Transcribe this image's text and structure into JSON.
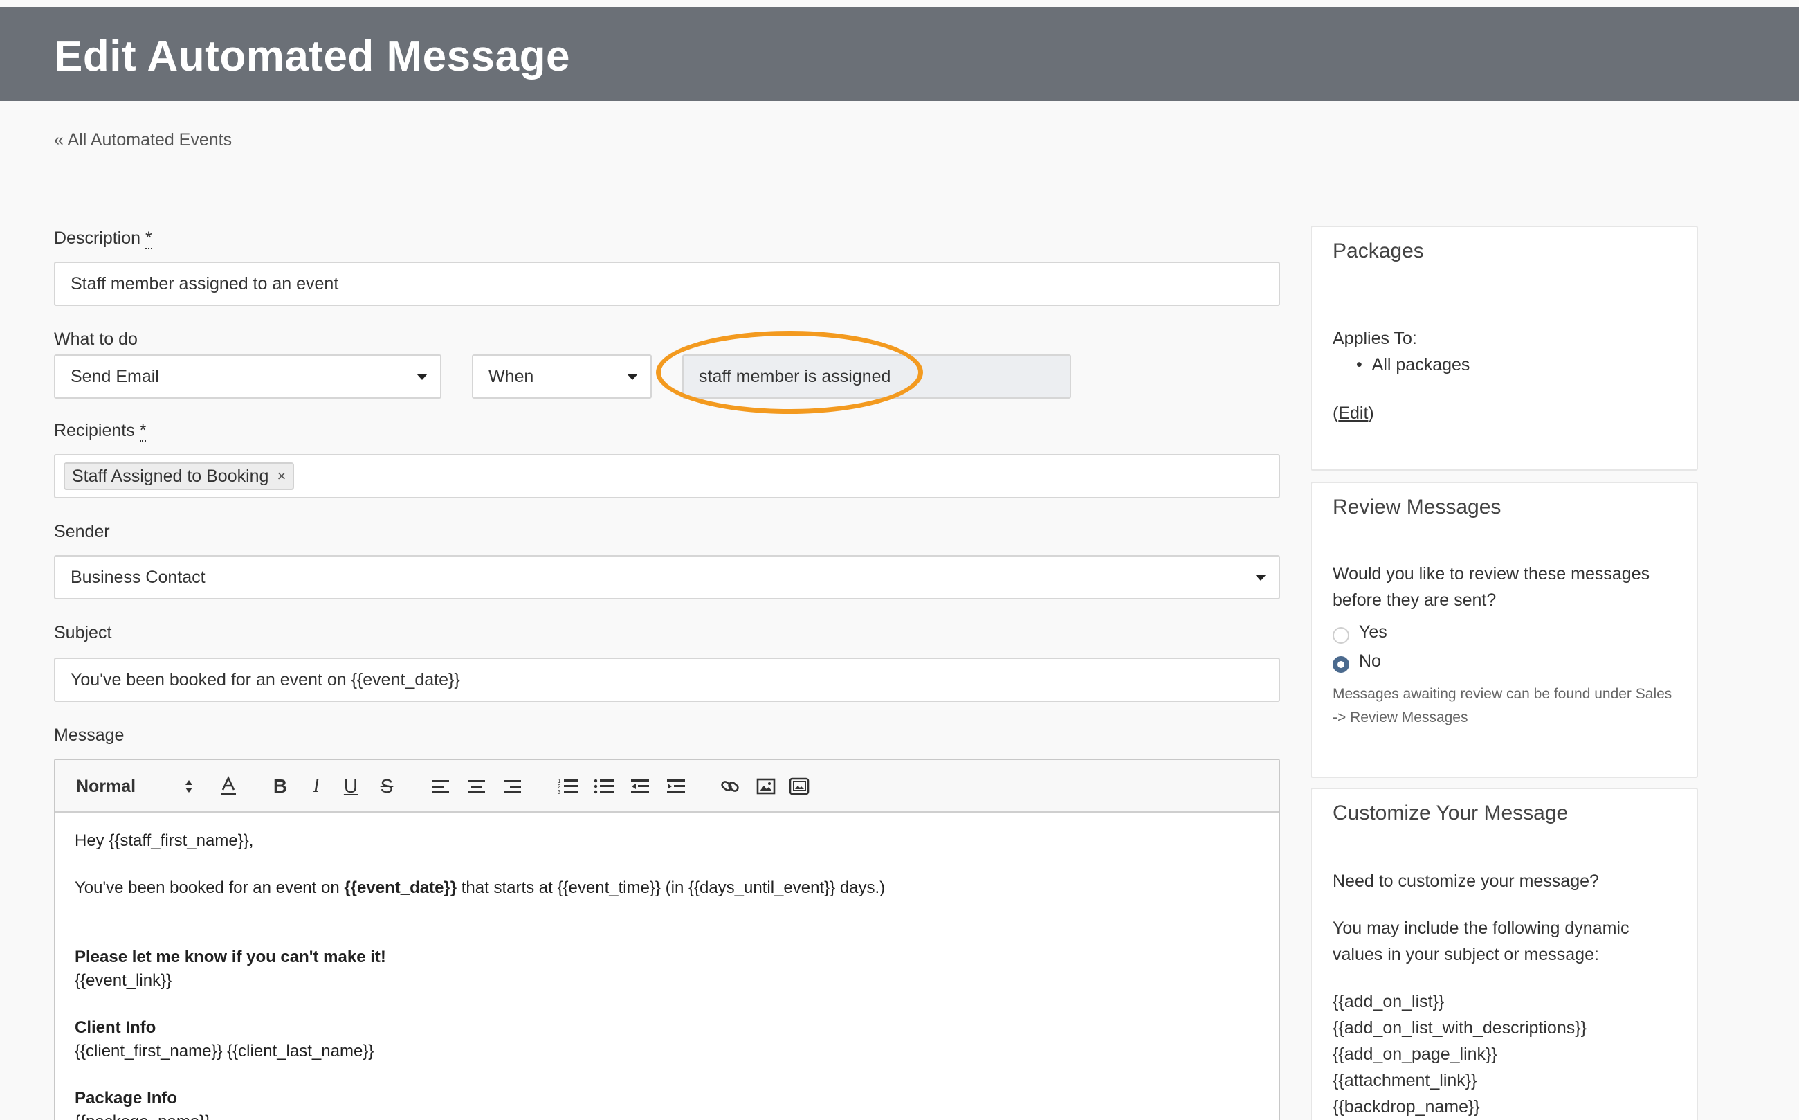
{
  "header": {
    "title": "Edit Automated Message"
  },
  "nav": {
    "back_link": "« All Automated Events"
  },
  "form": {
    "description": {
      "label": "Description",
      "required_mark": "*",
      "value": "Staff member assigned to an event"
    },
    "what_to_do": {
      "label": "What to do",
      "action_value": "Send Email",
      "timing_value": "When",
      "trigger_value": "staff member is assigned"
    },
    "recipients": {
      "label": "Recipients",
      "required_mark": "*",
      "tags": [
        {
          "label": "Staff Assigned to Booking",
          "remove": "×"
        }
      ]
    },
    "sender": {
      "label": "Sender",
      "value": "Business Contact"
    },
    "subject": {
      "label": "Subject",
      "value": "You've been booked for an event on {{event_date}}"
    },
    "message": {
      "label": "Message",
      "toolbar": {
        "format": "Normal"
      },
      "body": {
        "greeting": "Hey {{staff_first_name}},",
        "line1_pre": "You've been booked for an event on ",
        "line1_bold": "{{event_date}}",
        "line1_post": " that starts at {{event_time}} (in {{days_until_event}} days.)",
        "cta": "Please let me know if you can't make it!",
        "event_link": "{{event_link}}",
        "client_heading": "Client Info",
        "client_name": "{{client_first_name}} {{client_last_name}}",
        "package_heading": "Package Info",
        "package_name": "{{package_name}}"
      }
    }
  },
  "sidebar": {
    "packages": {
      "title": "Packages",
      "applies_label": "Applies To:",
      "applies_items": [
        "All packages"
      ],
      "edit_link": "Edit"
    },
    "review": {
      "title": "Review Messages",
      "question": "Would you like to review these messages before they are sent?",
      "options": [
        {
          "label": "Yes",
          "selected": false
        },
        {
          "label": "No",
          "selected": true
        }
      ],
      "note": "Messages awaiting review can be found under Sales -> Review Messages"
    },
    "customize": {
      "title": "Customize Your Message",
      "question": "Need to customize your message?",
      "intro": "You may include the following dynamic values in your subject or message:",
      "values": [
        "{{add_on_list}}",
        "{{add_on_list_with_descriptions}}",
        "{{add_on_page_link}}",
        "{{attachment_link}}",
        "{{backdrop_name}}"
      ]
    }
  },
  "colors": {
    "header_bg": "#6b7077",
    "highlight": "#f39a1f",
    "radio_selected": "#4b6a8e"
  }
}
